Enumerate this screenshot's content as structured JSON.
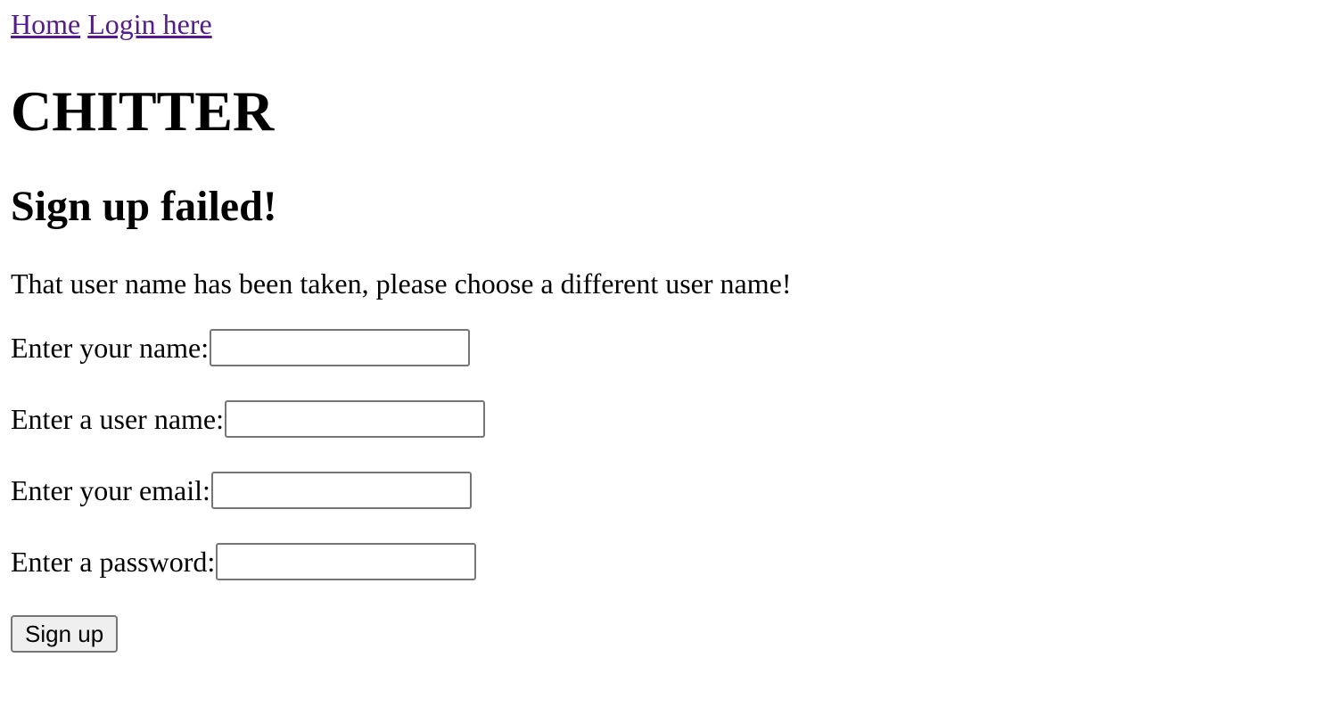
{
  "nav": {
    "home_label": "Home",
    "login_label": "Login here",
    "link_color": "#551a8b"
  },
  "header": {
    "title": "CHITTER",
    "subtitle": "Sign up failed!"
  },
  "message": {
    "text": "That user name has been taken, please choose a different user name!"
  },
  "form": {
    "name_label": "Enter your name:",
    "name_value": "",
    "username_label": "Enter a user name:",
    "username_value": "",
    "email_label": "Enter your email:",
    "email_value": "",
    "password_label": "Enter a password:",
    "password_value": "",
    "submit_label": "Sign up"
  }
}
